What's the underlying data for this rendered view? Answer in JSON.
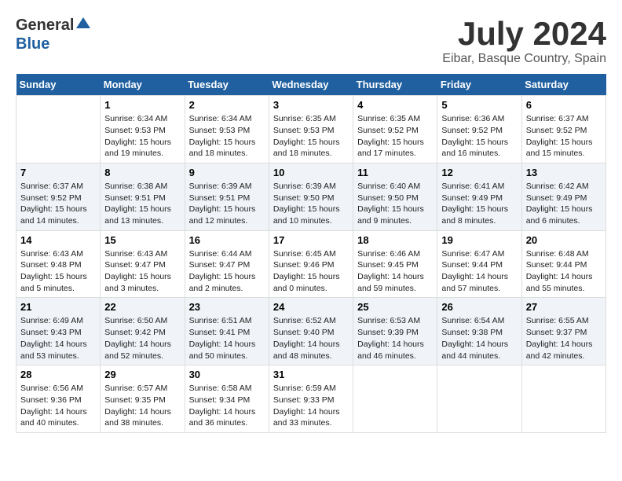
{
  "header": {
    "logo_general": "General",
    "logo_blue": "Blue",
    "month_title": "July 2024",
    "location": "Eibar, Basque Country, Spain"
  },
  "weekdays": [
    "Sunday",
    "Monday",
    "Tuesday",
    "Wednesday",
    "Thursday",
    "Friday",
    "Saturday"
  ],
  "weeks": [
    [
      {
        "day": "",
        "info": ""
      },
      {
        "day": "1",
        "info": "Sunrise: 6:34 AM\nSunset: 9:53 PM\nDaylight: 15 hours\nand 19 minutes."
      },
      {
        "day": "2",
        "info": "Sunrise: 6:34 AM\nSunset: 9:53 PM\nDaylight: 15 hours\nand 18 minutes."
      },
      {
        "day": "3",
        "info": "Sunrise: 6:35 AM\nSunset: 9:53 PM\nDaylight: 15 hours\nand 18 minutes."
      },
      {
        "day": "4",
        "info": "Sunrise: 6:35 AM\nSunset: 9:52 PM\nDaylight: 15 hours\nand 17 minutes."
      },
      {
        "day": "5",
        "info": "Sunrise: 6:36 AM\nSunset: 9:52 PM\nDaylight: 15 hours\nand 16 minutes."
      },
      {
        "day": "6",
        "info": "Sunrise: 6:37 AM\nSunset: 9:52 PM\nDaylight: 15 hours\nand 15 minutes."
      }
    ],
    [
      {
        "day": "7",
        "info": "Sunrise: 6:37 AM\nSunset: 9:52 PM\nDaylight: 15 hours\nand 14 minutes."
      },
      {
        "day": "8",
        "info": "Sunrise: 6:38 AM\nSunset: 9:51 PM\nDaylight: 15 hours\nand 13 minutes."
      },
      {
        "day": "9",
        "info": "Sunrise: 6:39 AM\nSunset: 9:51 PM\nDaylight: 15 hours\nand 12 minutes."
      },
      {
        "day": "10",
        "info": "Sunrise: 6:39 AM\nSunset: 9:50 PM\nDaylight: 15 hours\nand 10 minutes."
      },
      {
        "day": "11",
        "info": "Sunrise: 6:40 AM\nSunset: 9:50 PM\nDaylight: 15 hours\nand 9 minutes."
      },
      {
        "day": "12",
        "info": "Sunrise: 6:41 AM\nSunset: 9:49 PM\nDaylight: 15 hours\nand 8 minutes."
      },
      {
        "day": "13",
        "info": "Sunrise: 6:42 AM\nSunset: 9:49 PM\nDaylight: 15 hours\nand 6 minutes."
      }
    ],
    [
      {
        "day": "14",
        "info": "Sunrise: 6:43 AM\nSunset: 9:48 PM\nDaylight: 15 hours\nand 5 minutes."
      },
      {
        "day": "15",
        "info": "Sunrise: 6:43 AM\nSunset: 9:47 PM\nDaylight: 15 hours\nand 3 minutes."
      },
      {
        "day": "16",
        "info": "Sunrise: 6:44 AM\nSunset: 9:47 PM\nDaylight: 15 hours\nand 2 minutes."
      },
      {
        "day": "17",
        "info": "Sunrise: 6:45 AM\nSunset: 9:46 PM\nDaylight: 15 hours\nand 0 minutes."
      },
      {
        "day": "18",
        "info": "Sunrise: 6:46 AM\nSunset: 9:45 PM\nDaylight: 14 hours\nand 59 minutes."
      },
      {
        "day": "19",
        "info": "Sunrise: 6:47 AM\nSunset: 9:44 PM\nDaylight: 14 hours\nand 57 minutes."
      },
      {
        "day": "20",
        "info": "Sunrise: 6:48 AM\nSunset: 9:44 PM\nDaylight: 14 hours\nand 55 minutes."
      }
    ],
    [
      {
        "day": "21",
        "info": "Sunrise: 6:49 AM\nSunset: 9:43 PM\nDaylight: 14 hours\nand 53 minutes."
      },
      {
        "day": "22",
        "info": "Sunrise: 6:50 AM\nSunset: 9:42 PM\nDaylight: 14 hours\nand 52 minutes."
      },
      {
        "day": "23",
        "info": "Sunrise: 6:51 AM\nSunset: 9:41 PM\nDaylight: 14 hours\nand 50 minutes."
      },
      {
        "day": "24",
        "info": "Sunrise: 6:52 AM\nSunset: 9:40 PM\nDaylight: 14 hours\nand 48 minutes."
      },
      {
        "day": "25",
        "info": "Sunrise: 6:53 AM\nSunset: 9:39 PM\nDaylight: 14 hours\nand 46 minutes."
      },
      {
        "day": "26",
        "info": "Sunrise: 6:54 AM\nSunset: 9:38 PM\nDaylight: 14 hours\nand 44 minutes."
      },
      {
        "day": "27",
        "info": "Sunrise: 6:55 AM\nSunset: 9:37 PM\nDaylight: 14 hours\nand 42 minutes."
      }
    ],
    [
      {
        "day": "28",
        "info": "Sunrise: 6:56 AM\nSunset: 9:36 PM\nDaylight: 14 hours\nand 40 minutes."
      },
      {
        "day": "29",
        "info": "Sunrise: 6:57 AM\nSunset: 9:35 PM\nDaylight: 14 hours\nand 38 minutes."
      },
      {
        "day": "30",
        "info": "Sunrise: 6:58 AM\nSunset: 9:34 PM\nDaylight: 14 hours\nand 36 minutes."
      },
      {
        "day": "31",
        "info": "Sunrise: 6:59 AM\nSunset: 9:33 PM\nDaylight: 14 hours\nand 33 minutes."
      },
      {
        "day": "",
        "info": ""
      },
      {
        "day": "",
        "info": ""
      },
      {
        "day": "",
        "info": ""
      }
    ]
  ]
}
